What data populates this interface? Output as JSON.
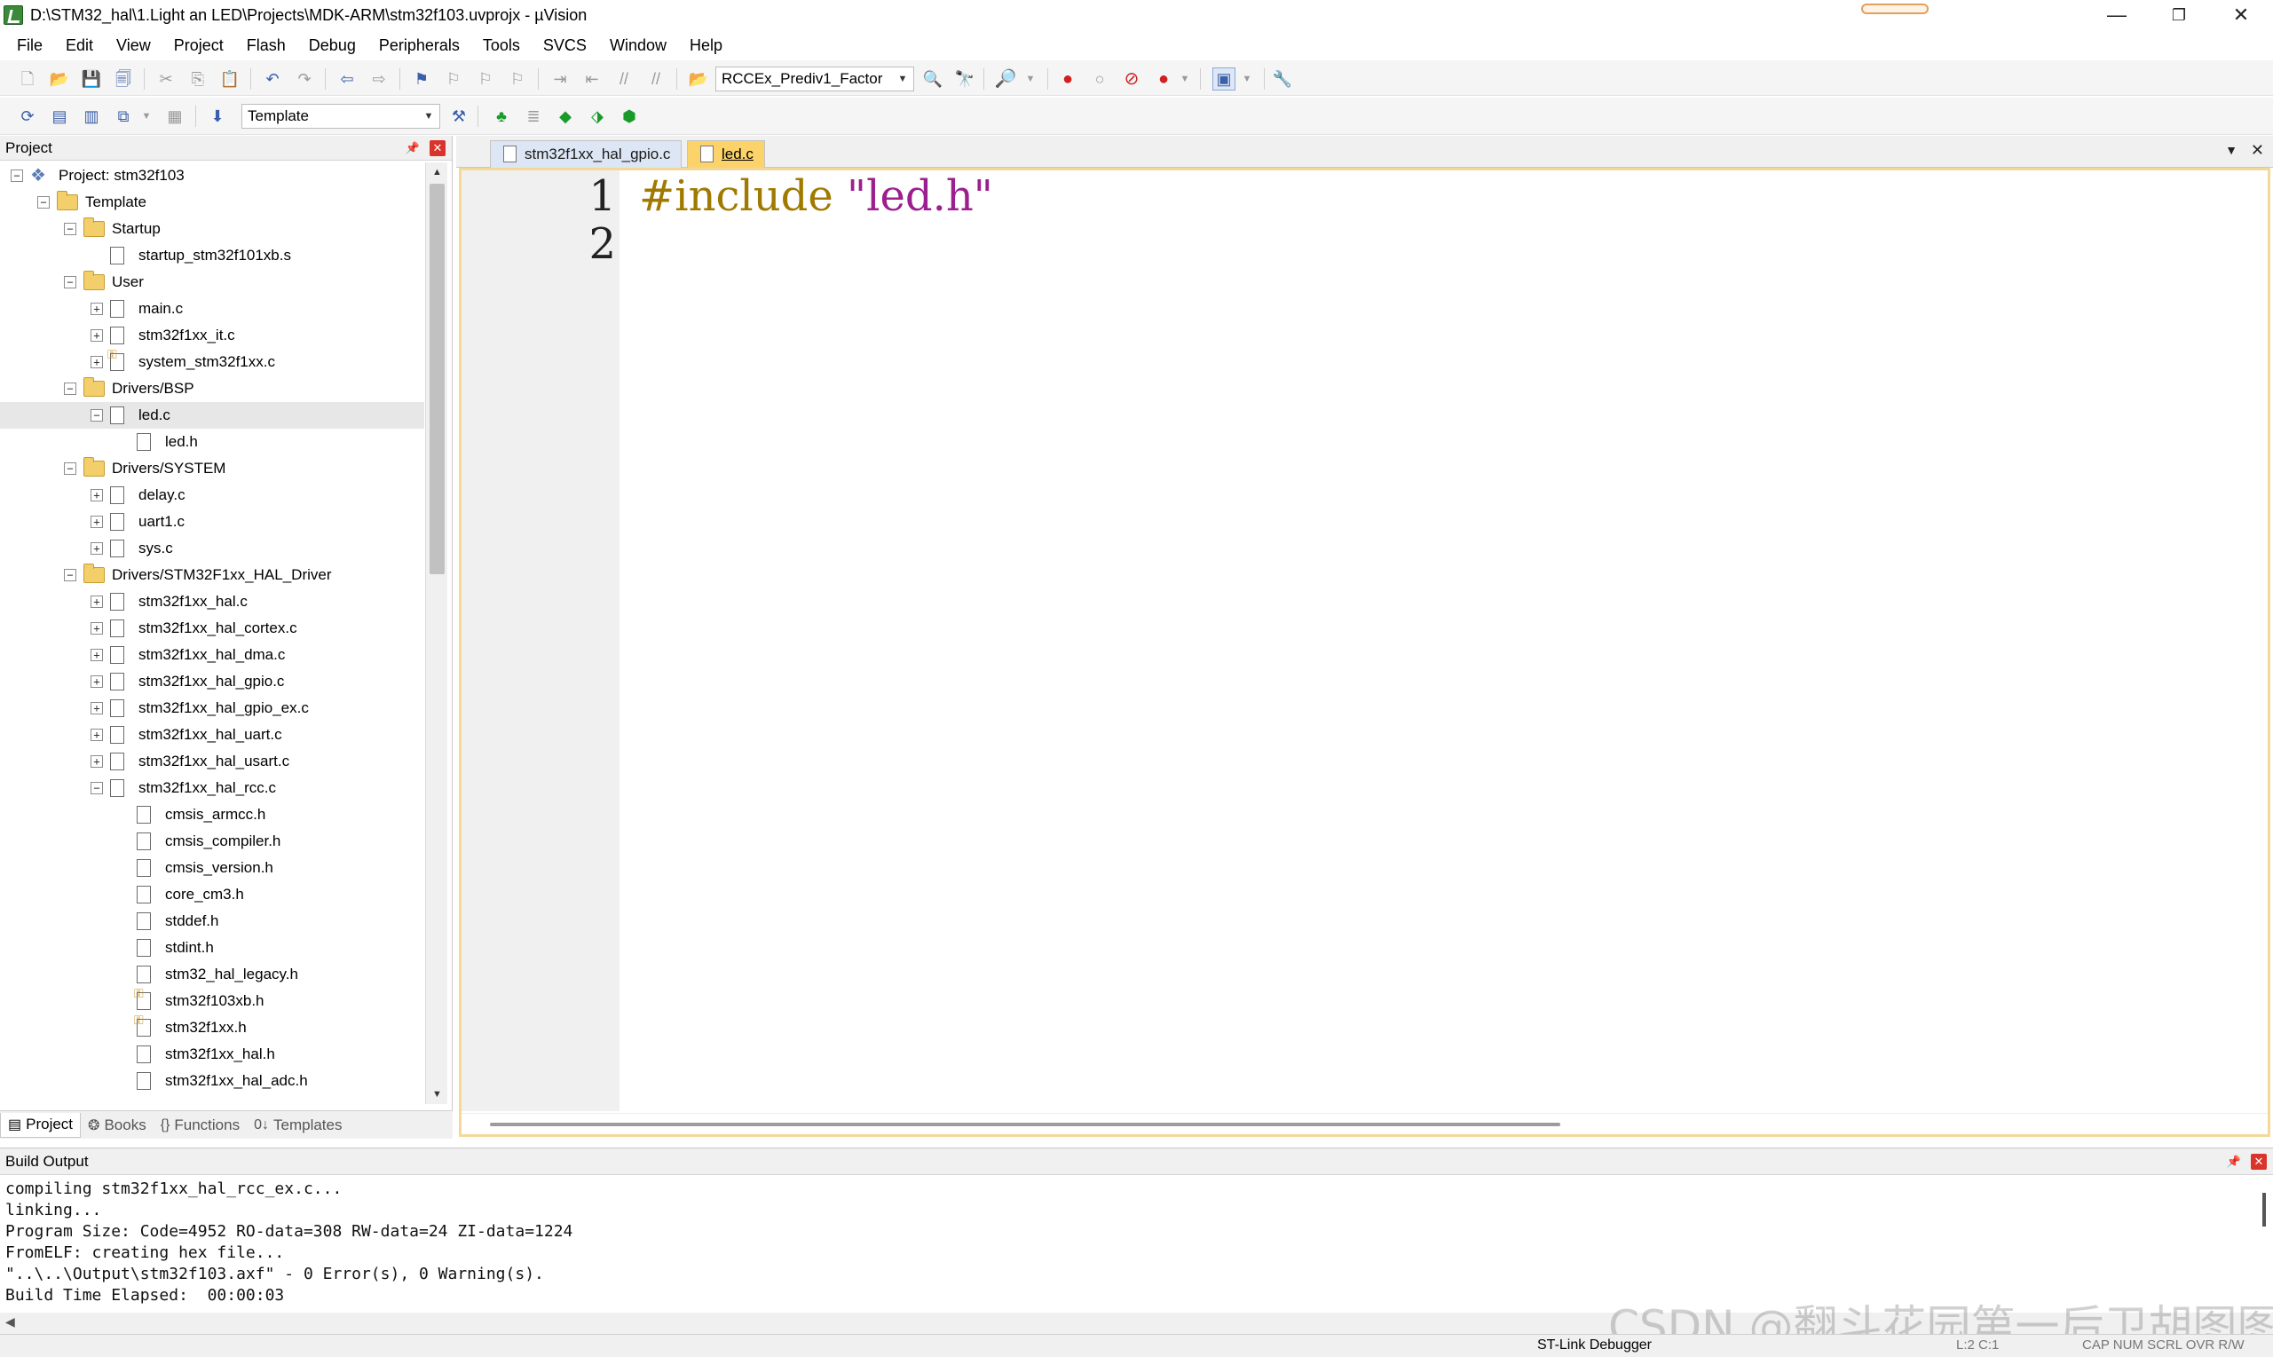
{
  "window": {
    "title": "D:\\STM32_hal\\1.Light an LED\\Projects\\MDK-ARM\\stm32f103.uvprojx - µVision",
    "minimize": "—",
    "restore": "❐",
    "close": "✕"
  },
  "menu": [
    "File",
    "Edit",
    "View",
    "Project",
    "Flash",
    "Debug",
    "Peripherals",
    "Tools",
    "SVCS",
    "Window",
    "Help"
  ],
  "toolbar1": {
    "find_combo": "RCCEx_Prediv1_Factor"
  },
  "toolbar2": {
    "target_combo": "Template"
  },
  "project_pane": {
    "title": "Project",
    "pin": "📌",
    "close": "✕",
    "tree": [
      {
        "label": "Project: stm32f103",
        "level": 0,
        "exp": "−",
        "icon": "project"
      },
      {
        "label": "Template",
        "level": 1,
        "exp": "−",
        "icon": "folder"
      },
      {
        "label": "Startup",
        "level": 2,
        "exp": "−",
        "icon": "folder"
      },
      {
        "label": "startup_stm32f101xb.s",
        "level": 3,
        "exp": "",
        "icon": "file"
      },
      {
        "label": "User",
        "level": 2,
        "exp": "−",
        "icon": "folder"
      },
      {
        "label": "main.c",
        "level": 3,
        "exp": "+",
        "icon": "file"
      },
      {
        "label": "stm32f1xx_it.c",
        "level": 3,
        "exp": "+",
        "icon": "file"
      },
      {
        "label": "system_stm32f1xx.c",
        "level": 3,
        "exp": "+",
        "icon": "file-key"
      },
      {
        "label": "Drivers/BSP",
        "level": 2,
        "exp": "−",
        "icon": "folder"
      },
      {
        "label": "led.c",
        "level": 3,
        "exp": "−",
        "icon": "file",
        "selected": true
      },
      {
        "label": "led.h",
        "level": 4,
        "exp": "",
        "icon": "file"
      },
      {
        "label": "Drivers/SYSTEM",
        "level": 2,
        "exp": "−",
        "icon": "folder"
      },
      {
        "label": "delay.c",
        "level": 3,
        "exp": "+",
        "icon": "file"
      },
      {
        "label": "uart1.c",
        "level": 3,
        "exp": "+",
        "icon": "file"
      },
      {
        "label": "sys.c",
        "level": 3,
        "exp": "+",
        "icon": "file"
      },
      {
        "label": "Drivers/STM32F1xx_HAL_Driver",
        "level": 2,
        "exp": "−",
        "icon": "folder"
      },
      {
        "label": "stm32f1xx_hal.c",
        "level": 3,
        "exp": "+",
        "icon": "file"
      },
      {
        "label": "stm32f1xx_hal_cortex.c",
        "level": 3,
        "exp": "+",
        "icon": "file"
      },
      {
        "label": "stm32f1xx_hal_dma.c",
        "level": 3,
        "exp": "+",
        "icon": "file"
      },
      {
        "label": "stm32f1xx_hal_gpio.c",
        "level": 3,
        "exp": "+",
        "icon": "file"
      },
      {
        "label": "stm32f1xx_hal_gpio_ex.c",
        "level": 3,
        "exp": "+",
        "icon": "file"
      },
      {
        "label": "stm32f1xx_hal_uart.c",
        "level": 3,
        "exp": "+",
        "icon": "file"
      },
      {
        "label": "stm32f1xx_hal_usart.c",
        "level": 3,
        "exp": "+",
        "icon": "file"
      },
      {
        "label": "stm32f1xx_hal_rcc.c",
        "level": 3,
        "exp": "−",
        "icon": "file"
      },
      {
        "label": "cmsis_armcc.h",
        "level": 4,
        "exp": "",
        "icon": "file"
      },
      {
        "label": "cmsis_compiler.h",
        "level": 4,
        "exp": "",
        "icon": "file"
      },
      {
        "label": "cmsis_version.h",
        "level": 4,
        "exp": "",
        "icon": "file"
      },
      {
        "label": "core_cm3.h",
        "level": 4,
        "exp": "",
        "icon": "file"
      },
      {
        "label": "stddef.h",
        "level": 4,
        "exp": "",
        "icon": "file"
      },
      {
        "label": "stdint.h",
        "level": 4,
        "exp": "",
        "icon": "file"
      },
      {
        "label": "stm32_hal_legacy.h",
        "level": 4,
        "exp": "",
        "icon": "file"
      },
      {
        "label": "stm32f103xb.h",
        "level": 4,
        "exp": "",
        "icon": "file-key"
      },
      {
        "label": "stm32f1xx.h",
        "level": 4,
        "exp": "",
        "icon": "file-key"
      },
      {
        "label": "stm32f1xx_hal.h",
        "level": 4,
        "exp": "",
        "icon": "file"
      },
      {
        "label": "stm32f1xx_hal_adc.h",
        "level": 4,
        "exp": "",
        "icon": "file"
      }
    ],
    "tabs": [
      {
        "label": "Project",
        "icon": "▤",
        "active": true
      },
      {
        "label": "Books",
        "icon": "❂",
        "active": false
      },
      {
        "label": "Functions",
        "icon": "{}",
        "active": false
      },
      {
        "label": "Templates",
        "icon": "0↓",
        "active": false
      }
    ]
  },
  "editor": {
    "tabs": [
      {
        "label": "stm32f1xx_hal_gpio.c",
        "active": false
      },
      {
        "label": "led.c",
        "active": true
      }
    ],
    "lines": [
      "1",
      "2"
    ],
    "code": {
      "keyword": "#include",
      "string": "\"led.h\""
    }
  },
  "build_output": {
    "title": "Build Output",
    "lines": [
      "compiling stm32f1xx_hal_rcc_ex.c...",
      "linking...",
      "Program Size: Code=4952 RO-data=308 RW-data=24 ZI-data=1224",
      "FromELF: creating hex file...",
      "\"..\\..\\Output\\stm32f103.axf\" - 0 Error(s), 0 Warning(s).",
      "Build Time Elapsed:  00:00:03"
    ]
  },
  "watermark": "CSDN @翻斗花园第一后卫胡图图",
  "status": {
    "debugger": "ST-Link Debugger",
    "position": "L:2 C:1",
    "flags": "CAP  NUM  SCRL  OVR  R/W"
  }
}
